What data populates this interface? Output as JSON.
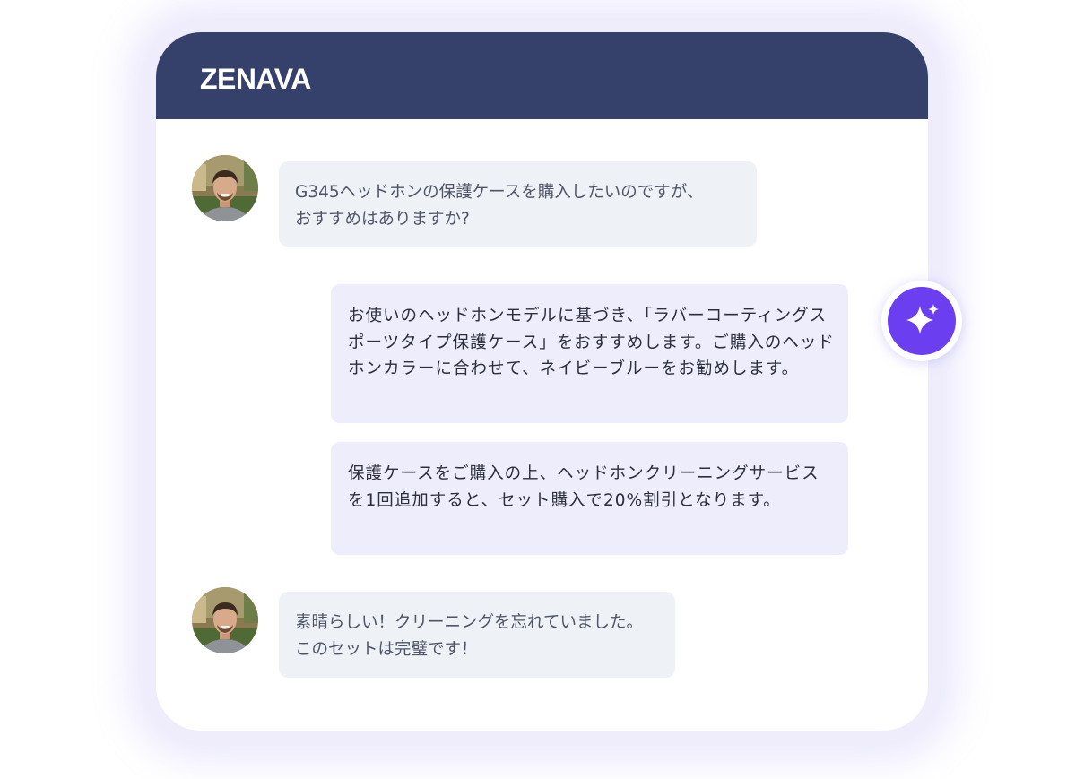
{
  "header": {
    "brand": "ZENAVA"
  },
  "messages": [
    {
      "sender": "user",
      "text": "G345ヘッドホンの保護ケースを購入したいのですが、\nおすすめはありますか?"
    },
    {
      "sender": "assistant",
      "text": "お使いのヘッドホンモデルに基づき、「ラバーコーティングスポーツタイプ保護ケース」をおすすめします。ご購入のヘッドホンカラーに合わせて、ネイビーブルーをお勧めします。"
    },
    {
      "sender": "assistant",
      "text": "保護ケースをご購入の上、ヘッドホンクリーニングサービスを1回追加すると、セット購入で20%割引となります。"
    },
    {
      "sender": "user",
      "text": "素晴らしい！クリーニングを忘れていました。\nこのセットは完璧です！"
    }
  ],
  "icons": {
    "ai_badge": "sparkle-icon",
    "avatar": "user-avatar-photo"
  },
  "colors": {
    "header_bg": "#35406b",
    "user_bubble_bg": "#eef1f6",
    "assistant_bubble_bg": "#eeedfb",
    "ai_accent": "#6b3ff0",
    "frame": "#efedfc"
  }
}
